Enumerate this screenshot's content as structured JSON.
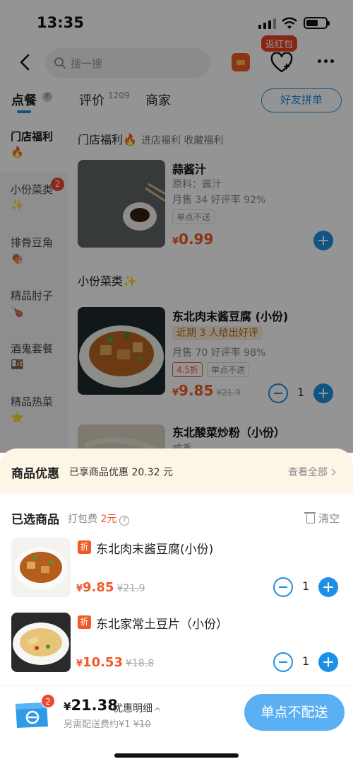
{
  "status_bar": {
    "time": "13:35"
  },
  "nav": {
    "search_placeholder": "搜一搜",
    "red_packet_badge": "返红包"
  },
  "tabs": {
    "order": "点餐",
    "order_badge": "不",
    "review": "评价",
    "review_count": "1209",
    "merchant": "商家",
    "group_order": "好友拼单"
  },
  "sidebar": {
    "items": [
      {
        "label": "门店福利",
        "emoji": "🔥",
        "active": true
      },
      {
        "label": "小份菜类",
        "emoji": "✨",
        "badge": "2"
      },
      {
        "label": "排骨豆角",
        "emoji": "🍖"
      },
      {
        "label": "精品肘子",
        "emoji": "🍗"
      },
      {
        "label": "酒鬼套餐",
        "emoji": "🍱"
      },
      {
        "label": "精品热菜",
        "emoji": "⭐"
      }
    ]
  },
  "menu": {
    "section1": {
      "title": "门店福利🔥",
      "subtitle": "进店福利 收藏福利"
    },
    "item1": {
      "name": "蒜酱汁",
      "ingredients": "原料：酱汁",
      "stats": "月售 34 好评率 92%",
      "tag": "单点不送",
      "yen": "¥",
      "price": "0.99"
    },
    "section2": {
      "title": "小份菜类✨"
    },
    "item2": {
      "name": "东北肉末酱豆腐 (小份)",
      "review_tag": "近期 3 人给出好评",
      "stats": "月售 70 好评率 98%",
      "discount_tag": "4.5折",
      "tag": "单点不送",
      "yen": "¥",
      "price": "9.85",
      "old_price": "¥21.9",
      "qty": "1"
    },
    "item3": {
      "name": "东北酸菜炒粉（小份）",
      "partial": "咸香"
    }
  },
  "cart": {
    "promo_title": "商品优惠",
    "promo_text": "已享商品优惠 20.32 元",
    "promo_link": "查看全部",
    "selected_title": "已选商品",
    "pack_fee_label": "打包费",
    "pack_fee_amount": "2元",
    "help": "?",
    "clear": "清空",
    "items": [
      {
        "disc": "折",
        "name": "东北肉末酱豆腐(小份)",
        "yen": "¥",
        "price": "9.85",
        "old_price": "¥21.9",
        "qty": "1"
      },
      {
        "disc": "折",
        "name": "东北家常土豆片（小份）",
        "yen": "¥",
        "price": "10.53",
        "old_price": "¥18.8",
        "qty": "1"
      }
    ]
  },
  "bottom": {
    "bag_badge": "2",
    "yen": "¥",
    "total": "21.38",
    "detail": "优惠明细",
    "delivery_note": "另需配送费约¥1",
    "delivery_old": "¥10",
    "order_button": "单点不配送"
  },
  "colors": {
    "accent": "#1c8fe6",
    "price": "#f05a28",
    "promo_bg": "#fdf6e7",
    "button": "#5bb0f3"
  }
}
